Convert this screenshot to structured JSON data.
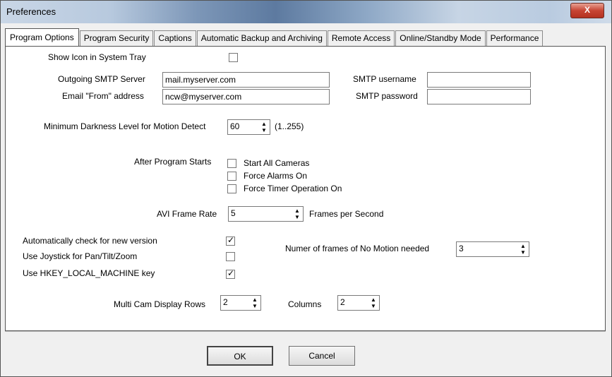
{
  "window": {
    "title": "Preferences",
    "close_label": "X"
  },
  "tabs": [
    {
      "label": "Program Options"
    },
    {
      "label": "Program Security"
    },
    {
      "label": "Captions"
    },
    {
      "label": "Automatic Backup and Archiving"
    },
    {
      "label": "Remote Access"
    },
    {
      "label": "Online/Standby Mode"
    },
    {
      "label": "Performance"
    }
  ],
  "options": {
    "show_icon_label": "Show Icon in System Tray",
    "show_icon_checked": false,
    "smtp_server_label": "Outgoing SMTP Server",
    "smtp_server_value": "mail.myserver.com",
    "email_from_label": "Email \"From\" address",
    "email_from_value": "ncw@myserver.com",
    "smtp_username_label": "SMTP username",
    "smtp_username_value": "",
    "smtp_password_label": "SMTP password",
    "smtp_password_value": "",
    "darkness_label": "Minimum Darkness Level for Motion Detect",
    "darkness_value": "60",
    "darkness_range": "(1..255)",
    "after_start_label": "After Program Starts",
    "start_all_cameras_label": "Start All Cameras",
    "force_alarms_label": "Force Alarms On",
    "force_timer_label": "Force Timer Operation On",
    "avi_rate_label": "AVI Frame Rate",
    "avi_rate_value": "5",
    "fps_label": "Frames per Second",
    "auto_check_label": "Automatically check for new version",
    "auto_check_checked": true,
    "joystick_label": "Use Joystick for Pan/Tilt/Zoom",
    "joystick_checked": false,
    "hkey_label": "Use HKEY_LOCAL_MACHINE key",
    "hkey_checked": true,
    "no_motion_label": "Numer of frames of No Motion needed",
    "no_motion_value": "3",
    "rows_label": "Multi Cam Display Rows",
    "rows_value": "2",
    "columns_label": "Columns",
    "columns_value": "2"
  },
  "buttons": {
    "ok": "OK",
    "cancel": "Cancel"
  },
  "check_glyph": "✓",
  "spinner": {
    "up": "▲",
    "down": "▼"
  }
}
